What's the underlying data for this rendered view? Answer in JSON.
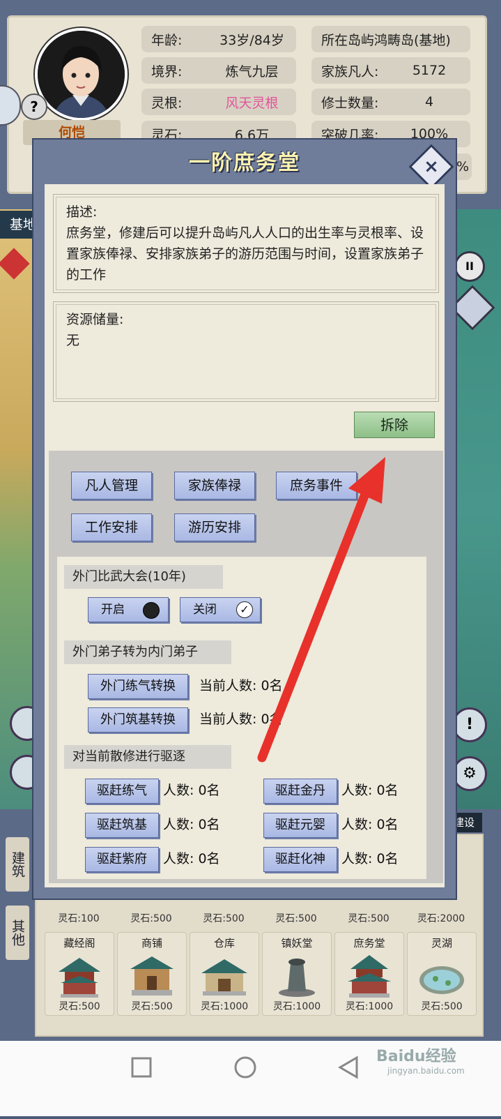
{
  "profile": {
    "name": "何恺",
    "help_label": "?",
    "stats": [
      {
        "label": "年龄:",
        "value": "33岁/84岁"
      },
      {
        "label": "境界:",
        "value": "炼气九层"
      },
      {
        "label": "灵根:",
        "value": "风天灵根",
        "color": "#e0559a"
      },
      {
        "label": "灵石:",
        "value": "6.6万"
      }
    ],
    "stats_right": [
      {
        "text": "所在岛屿鸿畴岛(基地)"
      },
      {
        "label": "家族凡人:",
        "value": "5172"
      },
      {
        "label": "修士数量:",
        "value": "4"
      },
      {
        "label": "突破几率:",
        "value": "100%"
      }
    ],
    "partial_right": "%"
  },
  "map": {
    "base_label": "基地",
    "right_cut": "3"
  },
  "modal": {
    "title": "一阶庶务堂",
    "close_label": "×",
    "description_label": "描述:",
    "description": "庶务堂，修建后可以提升岛屿凡人人口的出生率与灵根率、设置家族俸禄、安排家族弟子的游历范围与时间，设置家族弟子的工作",
    "resource_label": "资源储量:",
    "resource_value": "无",
    "demolish_label": "拆除",
    "menu_buttons": [
      "凡人管理",
      "家族俸禄",
      "庶务事件",
      "工作安排",
      "游历安排"
    ],
    "tournament": {
      "heading": "外门比武大会(10年)",
      "on_label": "开启",
      "off_label": "关闭",
      "selected": "关闭"
    },
    "promotion": {
      "heading": "外门弟子转为内门弟子",
      "rows": [
        {
          "button": "外门练气转换",
          "count_label": "当前人数: 0名"
        },
        {
          "button": "外门筑基转换",
          "count_label": "当前人数: 0名"
        }
      ]
    },
    "expel": {
      "heading": "对当前散修进行驱逐",
      "rows": [
        {
          "button": "驱赶练气",
          "count_label": "人数: 0名"
        },
        {
          "button": "驱赶金丹",
          "count_label": "人数: 0名"
        },
        {
          "button": "驱赶筑基",
          "count_label": "人数: 0名"
        },
        {
          "button": "驱赶元婴",
          "count_label": "人数: 0名"
        },
        {
          "button": "驱赶紫府",
          "count_label": "人数: 0名"
        },
        {
          "button": "驱赶化神",
          "count_label": "人数: 0名"
        }
      ]
    }
  },
  "build_panel": {
    "tag": "建设",
    "side_tabs": [
      "建筑",
      "其他"
    ],
    "row1_costs": [
      "灵石:100",
      "灵石:500",
      "灵石:500",
      "灵石:500",
      "灵石:500",
      "灵石:2000"
    ],
    "buildings": [
      {
        "name": "藏经阁",
        "cost": "灵石:500"
      },
      {
        "name": "商铺",
        "cost": "灵石:500"
      },
      {
        "name": "仓库",
        "cost": "灵石:1000"
      },
      {
        "name": "镇妖堂",
        "cost": "灵石:1000"
      },
      {
        "name": "庶务堂",
        "cost": "灵石:1000"
      },
      {
        "name": "灵湖",
        "cost": "灵石:500"
      }
    ]
  },
  "watermark": {
    "logo": "Baidu经验",
    "url": "jingyan.baidu.com"
  },
  "colors": {
    "arrow": "#e8312a",
    "title_text": "#fff3b0",
    "demolish_green": "#8dbf87",
    "button_blue": "#a9b8e4"
  }
}
